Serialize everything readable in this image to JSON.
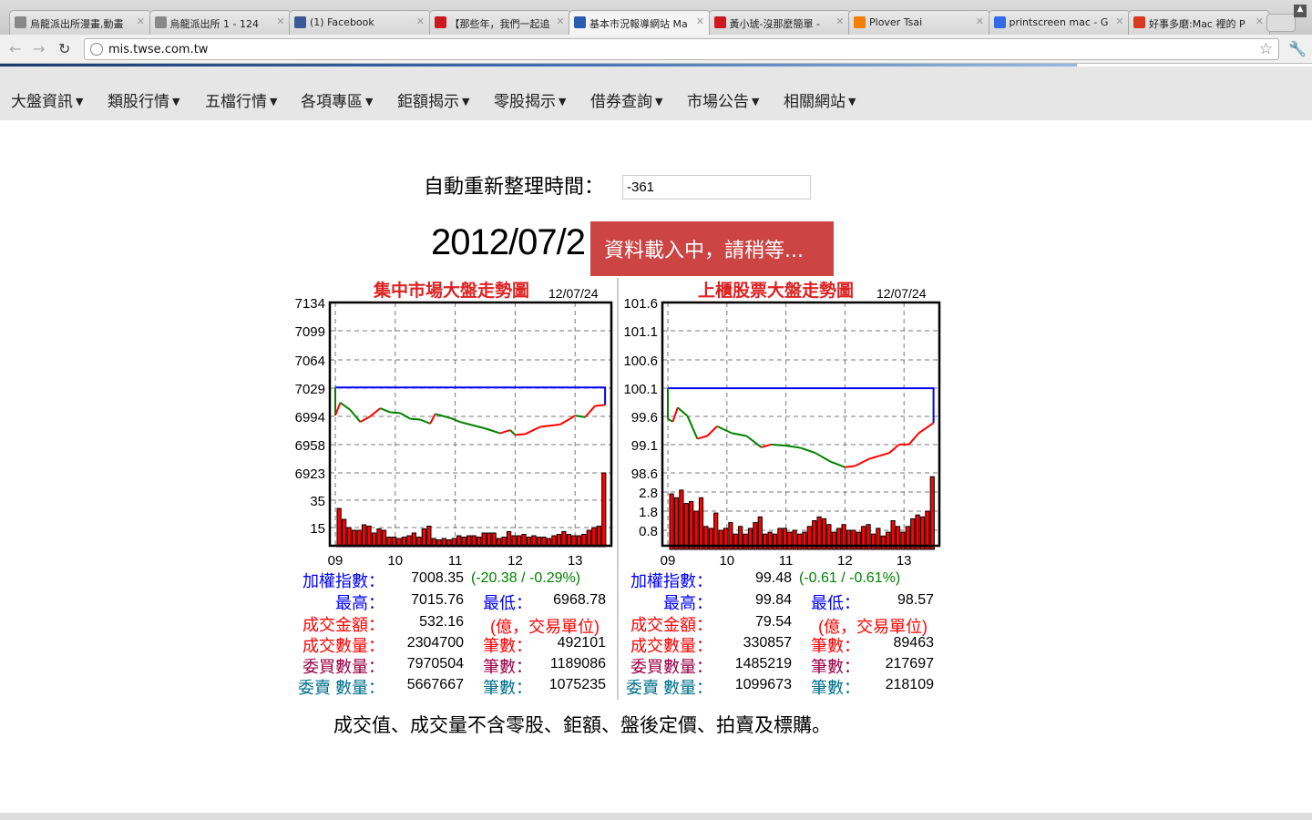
{
  "browser": {
    "tabs": [
      {
        "title": "烏龍派出所漫畫,動畫",
        "icon": "globe-icon",
        "color": "#888888"
      },
      {
        "title": "烏龍派出所 1 - 124",
        "icon": "globe-icon",
        "color": "#888888"
      },
      {
        "title": "(1) Facebook",
        "icon": "facebook-icon",
        "color": "#3b5998"
      },
      {
        "title": "【那些年，我們一起追",
        "icon": "youtube-icon",
        "color": "#cc181e"
      },
      {
        "title": "基本市況報導網站 Ma",
        "icon": "eye-icon",
        "color": "#2a5db0",
        "active": true
      },
      {
        "title": "黃小琥-沒那麼簡單 -",
        "icon": "youtube-icon",
        "color": "#cc181e"
      },
      {
        "title": "Plover Tsai",
        "icon": "blogger-icon",
        "color": "#f57d00"
      },
      {
        "title": "printscreen mac - G",
        "icon": "google-icon",
        "color": "#3369e8"
      },
      {
        "title": "好事多磨:Mac 裡的 P",
        "icon": "readability-icon",
        "color": "#d93a1f"
      }
    ],
    "url": "mis.twse.com.tw"
  },
  "nav": [
    "大盤資訊",
    "類股行情",
    "五檔行情",
    "各項專區",
    "鉅額揭示",
    "零股揭示",
    "借券查詢",
    "市場公告",
    "相關網站"
  ],
  "refresh": {
    "label": "自動重新整理時間：",
    "value": "-361"
  },
  "date": "2012/07/2",
  "loading": "資料載入中，請稍等...",
  "colors": {
    "up": "#ff0000",
    "down": "#008000",
    "flat": "#0000ff",
    "prev_close": "#0000ff",
    "volume": "#ff0000"
  },
  "chart_data": [
    {
      "type": "line",
      "title": "集中市場大盤走勢圖",
      "date": "12/07/24",
      "prev_close": 7028.73,
      "x_ticks": [
        "09",
        "10",
        "11",
        "12",
        "13"
      ],
      "y_ticks": [
        "7134",
        "7099",
        "7064",
        "7029",
        "6994",
        "6958",
        "6923"
      ],
      "volume_ticks": [
        "35",
        "15"
      ],
      "ylim": [
        6923,
        7134
      ],
      "series": [
        [
          "09:00",
          6994
        ],
        [
          "09:05",
          7010
        ],
        [
          "09:15",
          7001
        ],
        [
          "09:25",
          6986
        ],
        [
          "09:35",
          6993
        ],
        [
          "09:45",
          7003
        ],
        [
          "09:55",
          6998
        ],
        [
          "10:05",
          6997
        ],
        [
          "10:15",
          6990
        ],
        [
          "10:25",
          6989
        ],
        [
          "10:35",
          6984
        ],
        [
          "10:40",
          6996
        ],
        [
          "10:55",
          6991
        ],
        [
          "11:05",
          6986
        ],
        [
          "11:30",
          6978
        ],
        [
          "11:45",
          6972
        ],
        [
          "11:55",
          6976
        ],
        [
          "12:00",
          6970
        ],
        [
          "12:10",
          6971
        ],
        [
          "12:25",
          6980
        ],
        [
          "12:45",
          6983
        ],
        [
          "12:55",
          6990
        ],
        [
          "13:00",
          6994
        ],
        [
          "13:10",
          6992
        ],
        [
          "13:20",
          7006
        ],
        [
          "13:30",
          7007
        ]
      ],
      "volume": [
        28,
        20,
        14,
        12,
        12,
        16,
        15,
        10,
        13,
        12,
        7,
        7,
        6,
        7,
        8,
        10,
        7,
        13,
        15,
        6,
        5,
        6,
        5,
        6,
        8,
        7,
        8,
        8,
        7,
        10,
        10,
        10,
        6,
        7,
        11,
        8,
        8,
        9,
        7,
        8,
        7,
        7,
        6,
        8,
        9,
        11,
        9,
        8,
        8,
        9,
        12,
        14,
        15,
        54
      ]
    },
    {
      "type": "line",
      "title": "上櫃股票大盤走勢圖",
      "date": "12/07/24",
      "prev_close": 100.09,
      "x_ticks": [
        "09",
        "10",
        "11",
        "12",
        "13"
      ],
      "y_ticks": [
        "101.6",
        "101.1",
        "100.6",
        "100.1",
        "99.6",
        "99.1",
        "98.6"
      ],
      "volume_ticks": [
        "2.8",
        "1.8",
        "0.8"
      ],
      "ylim": [
        98.6,
        101.6
      ],
      "series": [
        [
          "09:00",
          99.55
        ],
        [
          "09:05",
          99.5
        ],
        [
          "09:10",
          99.75
        ],
        [
          "09:20",
          99.6
        ],
        [
          "09:30",
          99.2
        ],
        [
          "09:40",
          99.25
        ],
        [
          "09:50",
          99.42
        ],
        [
          "10:05",
          99.3
        ],
        [
          "10:20",
          99.25
        ],
        [
          "10:35",
          99.05
        ],
        [
          "10:45",
          99.1
        ],
        [
          "11:00",
          99.08
        ],
        [
          "11:15",
          99.04
        ],
        [
          "11:30",
          98.95
        ],
        [
          "11:45",
          98.8
        ],
        [
          "12:00",
          98.7
        ],
        [
          "12:10",
          98.72
        ],
        [
          "12:25",
          98.85
        ],
        [
          "12:35",
          98.9
        ],
        [
          "12:45",
          98.95
        ],
        [
          "12:55",
          99.1
        ],
        [
          "13:05",
          99.1
        ],
        [
          "13:15",
          99.3
        ],
        [
          "13:30",
          99.48
        ]
      ],
      "volume": [
        2.9,
        2.7,
        3.1,
        2.4,
        2.5,
        2.0,
        2.7,
        1.2,
        1.1,
        1.9,
        1.0,
        1.1,
        1.4,
        0.8,
        1.2,
        0.8,
        1.1,
        1.4,
        1.7,
        0.8,
        0.9,
        0.8,
        1.1,
        1.1,
        0.9,
        1.0,
        0.8,
        0.9,
        1.2,
        1.5,
        1.7,
        1.6,
        1.3,
        0.9,
        1.1,
        1.3,
        1.0,
        1.0,
        0.9,
        1.2,
        1.3,
        0.8,
        1.1,
        0.7,
        0.9,
        1.5,
        1.2,
        0.9,
        1.2,
        1.6,
        1.8,
        1.7,
        2.0,
        3.8
      ]
    }
  ],
  "stats": [
    {
      "index_label": "加權指數：",
      "index": "7008.35",
      "change": "(-20.38 / -0.29%)",
      "high_label": "最高：",
      "high": "7015.76",
      "low_label": "最低：",
      "low": "6968.78",
      "amount_label": "成交金額：",
      "amount": "532.16",
      "unit": "(億，交易單位)",
      "vol_label": "成交數量：",
      "vol": "2304700",
      "cnt_label": "筆數：",
      "vol_cnt": "492101",
      "bid_label": "委買數量：",
      "bid": "7970504",
      "bid_cnt": "1189086",
      "ask_label": "委賣 數量：",
      "ask": "5667667",
      "ask_cnt": "1075235"
    },
    {
      "index_label": "加權指數：",
      "index": "99.48",
      "change": "(-0.61 / -0.61%)",
      "high_label": "最高：",
      "high": "99.84",
      "low_label": "最低：",
      "low": "98.57",
      "amount_label": "成交金額：",
      "amount": "79.54",
      "unit": "(億，交易單位)",
      "vol_label": "成交數量：",
      "vol": "330857",
      "cnt_label": "筆數：",
      "vol_cnt": "89463",
      "bid_label": "委買數量：",
      "bid": "1485219",
      "bid_cnt": "217697",
      "ask_label": "委賣 數量：",
      "ask": "1099673",
      "ask_cnt": "218109"
    }
  ],
  "note": "成交值、成交量不含零股、鉅額、盤後定價、拍賣及標購。"
}
